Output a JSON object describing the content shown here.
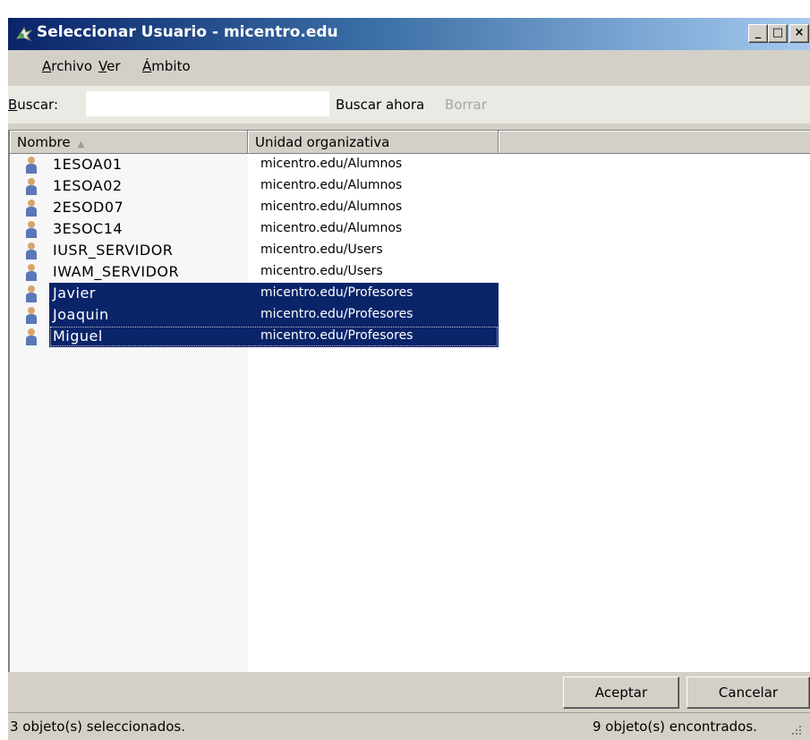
{
  "window": {
    "title": "Seleccionar Usuario - micentro.edu"
  },
  "menu": [
    "Archivo",
    "Ver",
    "Ámbito"
  ],
  "search": {
    "label": "Buscar:",
    "value": "",
    "search_now": "Buscar ahora",
    "clear": "Borrar"
  },
  "columns": {
    "name": "Nombre",
    "ou": "Unidad organizativa"
  },
  "rows": [
    {
      "name": "1ESOA01",
      "ou": "micentro.edu/Alumnos",
      "selected": false
    },
    {
      "name": "1ESOA02",
      "ou": "micentro.edu/Alumnos",
      "selected": false
    },
    {
      "name": "2ESOD07",
      "ou": "micentro.edu/Alumnos",
      "selected": false
    },
    {
      "name": "3ESOC14",
      "ou": "micentro.edu/Alumnos",
      "selected": false
    },
    {
      "name": "IUSR_SERVIDOR",
      "ou": "micentro.edu/Users",
      "selected": false
    },
    {
      "name": "IWAM_SERVIDOR",
      "ou": "micentro.edu/Users",
      "selected": false
    },
    {
      "name": "Javier",
      "ou": "micentro.edu/Profesores",
      "selected": true
    },
    {
      "name": "Joaquin",
      "ou": "micentro.edu/Profesores",
      "selected": true
    },
    {
      "name": "Miguel",
      "ou": "micentro.edu/Profesores",
      "selected": true
    }
  ],
  "buttons": {
    "ok": "Aceptar",
    "cancel": "Cancelar"
  },
  "status": {
    "left": "3 objeto(s) seleccionados.",
    "right": "9 objeto(s) encontrados."
  },
  "colors": {
    "title_start": "#0a246a",
    "title_end": "#a6caf0",
    "selection": "#0a246a",
    "face": "#d4d0c8"
  },
  "icons": {
    "app": "select-users-icon",
    "row": "user-icon"
  }
}
